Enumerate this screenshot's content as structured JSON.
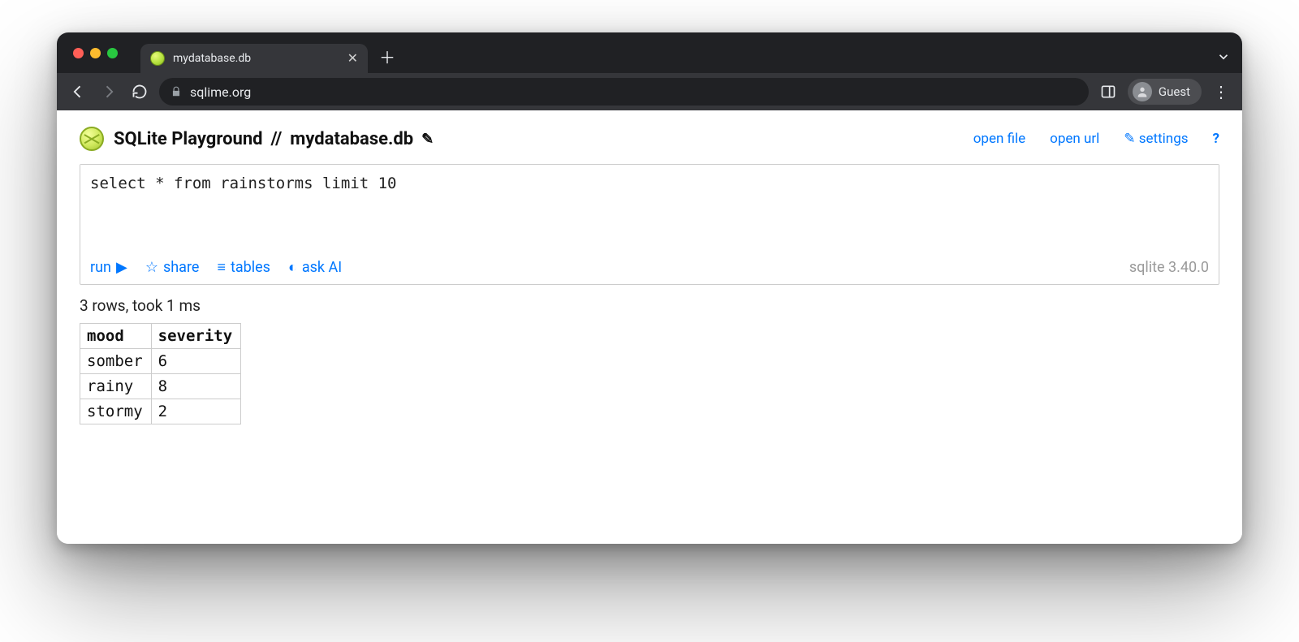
{
  "browser": {
    "tab_title": "mydatabase.db",
    "url": "sqlime.org",
    "profile_label": "Guest"
  },
  "header": {
    "app_name": "SQLite Playground",
    "separator": "//",
    "db_name": "mydatabase.db",
    "links": {
      "open_file": "open file",
      "open_url": "open url",
      "settings": "settings",
      "help": "?"
    }
  },
  "editor": {
    "query": "select * from rainstorms limit 10",
    "toolbar": {
      "run": "run",
      "share": "share",
      "tables": "tables",
      "ask_ai": "ask AI"
    },
    "version": "sqlite 3.40.0"
  },
  "result": {
    "status": "3 rows, took 1 ms",
    "columns": [
      "mood",
      "severity"
    ],
    "rows": [
      {
        "mood": "somber",
        "severity": "6"
      },
      {
        "mood": "rainy",
        "severity": "8"
      },
      {
        "mood": "stormy",
        "severity": "2"
      }
    ]
  }
}
